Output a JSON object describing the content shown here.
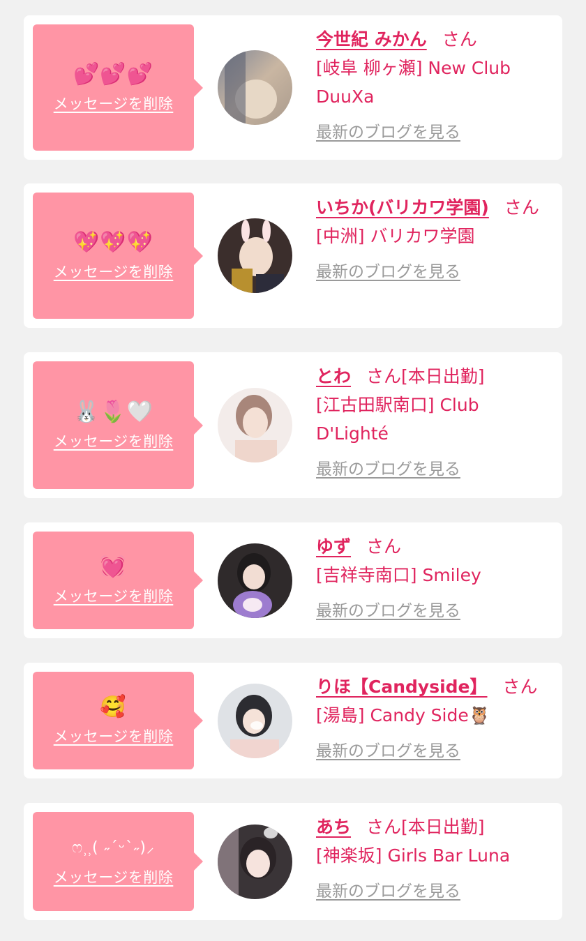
{
  "colors": {
    "page_bg": "#f1f1f1",
    "card_bg": "#ffffff",
    "bubble_bg": "#ff95a5",
    "accent": "#e0245e",
    "link_gray": "#9a9a9a"
  },
  "delete_label": "メッセージを削除",
  "blog_label": "最新のブログを見る",
  "san_label": "さん",
  "items": [
    {
      "message": "💕💕💕",
      "name": "今世紀 みかん",
      "tag": "",
      "shop": "[岐阜 柳ヶ瀬] New Club DuuXa"
    },
    {
      "message": "💖💖💖",
      "name": "いちか(バリカワ学園)",
      "tag": "",
      "shop": "[中洲] バリカワ学園"
    },
    {
      "message": "🐰🌷🤍",
      "name": "とわ",
      "tag": "[本日出勤]",
      "shop": "[江古田駅南口] Club D'Lighté"
    },
    {
      "message": "💓",
      "name": "ゆず",
      "tag": "",
      "shop": "[吉祥寺南口] Smiley"
    },
    {
      "message": "🥰",
      "name": "りほ【Candyside】",
      "tag": "",
      "shop": "[湯島] Candy Side🦉"
    },
    {
      "message": "ෆ⸒⸒( ˶ˊᵕˋ˶)⸝",
      "name": "あち",
      "tag": "[本日出勤]",
      "shop": "[神楽坂] Girls Bar Luna"
    }
  ]
}
